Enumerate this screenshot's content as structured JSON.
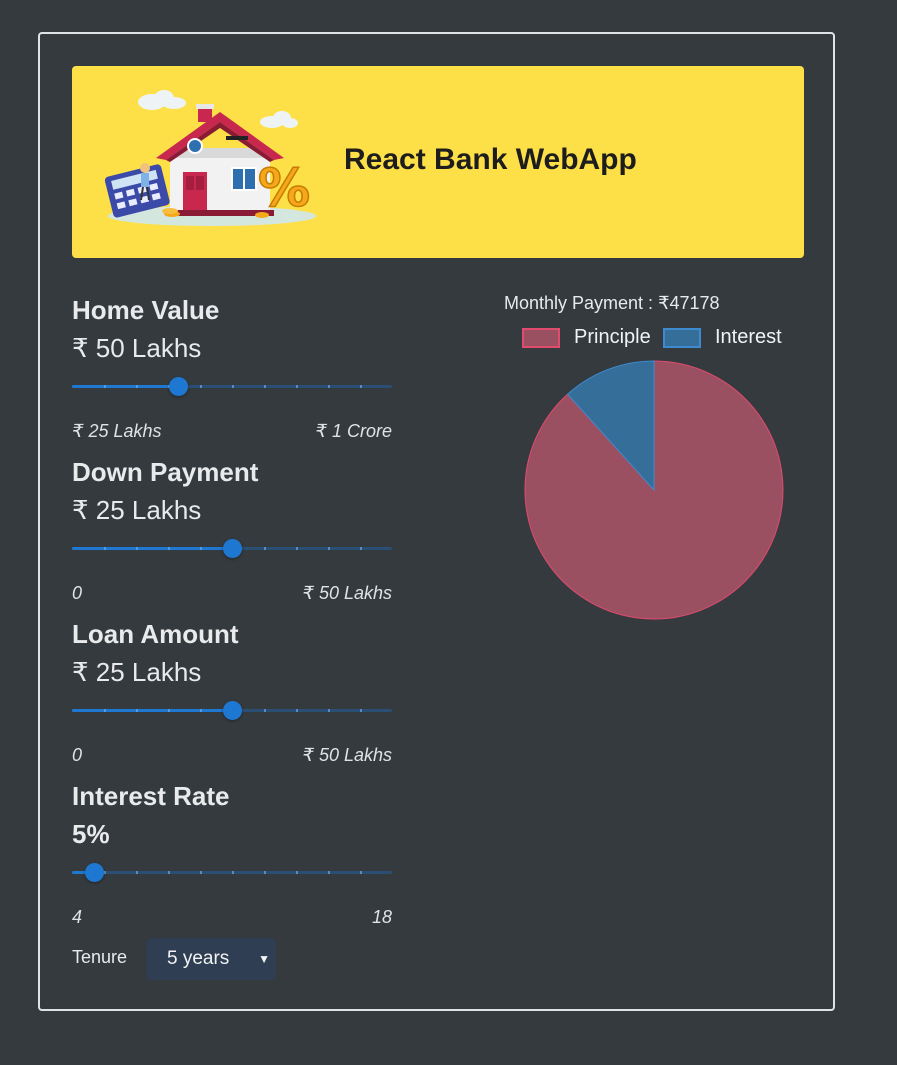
{
  "app": {
    "title": "React Bank WebApp",
    "banner_image": "house-savings-illustration",
    "banner_color": "#fde047"
  },
  "fields": {
    "home_value": {
      "label": "Home Value",
      "value": "₹ 50 Lakhs",
      "min_label": "₹ 25 Lakhs",
      "max_label": "₹ 1 Crore",
      "fraction": 0.333
    },
    "down_payment": {
      "label": "Down Payment",
      "value": "₹ 25 Lakhs",
      "min_label": "0",
      "max_label": "₹ 50 Lakhs",
      "fraction": 0.5
    },
    "loan_amount": {
      "label": "Loan Amount",
      "value": "₹ 25 Lakhs",
      "min_label": "0",
      "max_label": "₹ 50 Lakhs",
      "fraction": 0.5
    },
    "interest_rate": {
      "label": "Interest Rate",
      "value": "5%",
      "min_label": "4",
      "max_label": "18",
      "fraction": 0.071
    }
  },
  "tenure": {
    "label": "Tenure",
    "selected": "5 years"
  },
  "summary": {
    "monthly_payment": "Monthly Payment : ₹47178"
  },
  "chart_data": {
    "type": "pie",
    "labels": [
      "Principle",
      "Interest"
    ],
    "values": [
      2500000,
      330680
    ],
    "colors": [
      "#9b5061",
      "#356e98"
    ],
    "border_colors": [
      "#e04b6e",
      "#3d8ad0"
    ],
    "legend": "top"
  },
  "colors": {
    "accent": "#1e78d2",
    "background": "#343a3e"
  }
}
